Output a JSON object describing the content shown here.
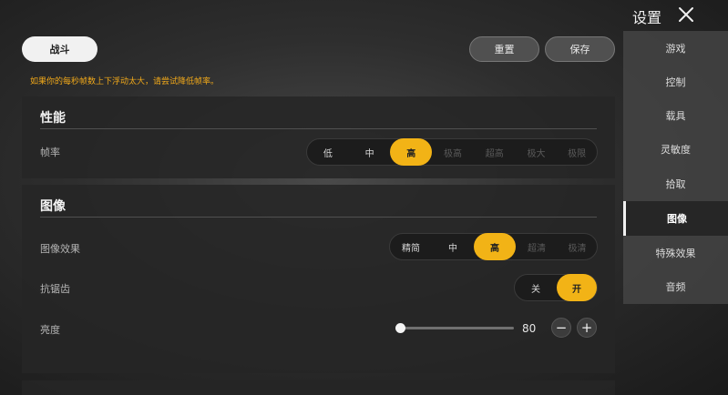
{
  "header": {
    "tab_label": "战斗",
    "reset_label": "重置",
    "save_label": "保存",
    "warning": "如果你的每秒帧数上下浮动太大，请尝试降低帧率。"
  },
  "sidebar": {
    "title": "设置",
    "items": [
      {
        "label": "游戏"
      },
      {
        "label": "控制"
      },
      {
        "label": "载具"
      },
      {
        "label": "灵敏度"
      },
      {
        "label": "拾取"
      },
      {
        "label": "图像"
      },
      {
        "label": "特殊效果"
      },
      {
        "label": "音频"
      }
    ],
    "active": "图像"
  },
  "performance": {
    "title": "性能",
    "frame_rate": {
      "label": "帧率",
      "options": [
        "低",
        "中",
        "高",
        "极高",
        "超高",
        "极大",
        "极限"
      ],
      "selected": "高"
    }
  },
  "graphics": {
    "title": "图像",
    "quality": {
      "label": "图像效果",
      "options": [
        "精简",
        "中",
        "高",
        "超清",
        "极清"
      ],
      "selected": "高"
    },
    "anti_aliasing": {
      "label": "抗锯齿",
      "options": [
        "关",
        "开"
      ],
      "selected": "开"
    },
    "brightness": {
      "label": "亮度",
      "value": "80",
      "fraction": 0.0,
      "minus": "−",
      "plus": "+"
    }
  },
  "colors": {
    "accent": "#f2b316",
    "warning": "#f0a81a"
  }
}
